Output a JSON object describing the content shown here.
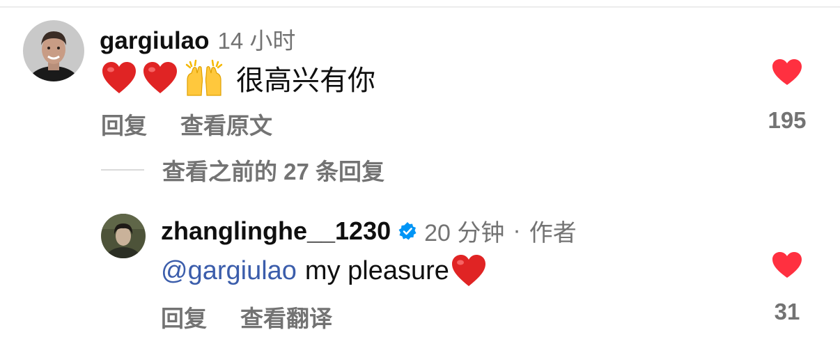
{
  "comments": [
    {
      "username": "gargiulao",
      "time": "14 小时",
      "emojis": [
        "red-heart",
        "red-heart",
        "raising-hands"
      ],
      "text": "很高兴有你",
      "actions": {
        "reply": "回复",
        "view_original": "查看原文"
      },
      "like_count": "195"
    },
    {
      "username": "zhanglinghe__1230",
      "verified": true,
      "time": "20 分钟",
      "separator": "·",
      "author_label": "作者",
      "mention": "@gargiulao",
      "text": "my pleasure",
      "trailing_emoji": "red-heart",
      "actions": {
        "reply": "回复",
        "view_translation": "查看翻译"
      },
      "like_count": "31"
    }
  ],
  "view_previous_replies": "查看之前的 27 条回复",
  "colors": {
    "like_heart": "#ff3040",
    "verified_badge": "#0095f6",
    "mention": "#3b5dab",
    "secondary_text": "#737373",
    "primary_text": "#0f0f0f"
  }
}
